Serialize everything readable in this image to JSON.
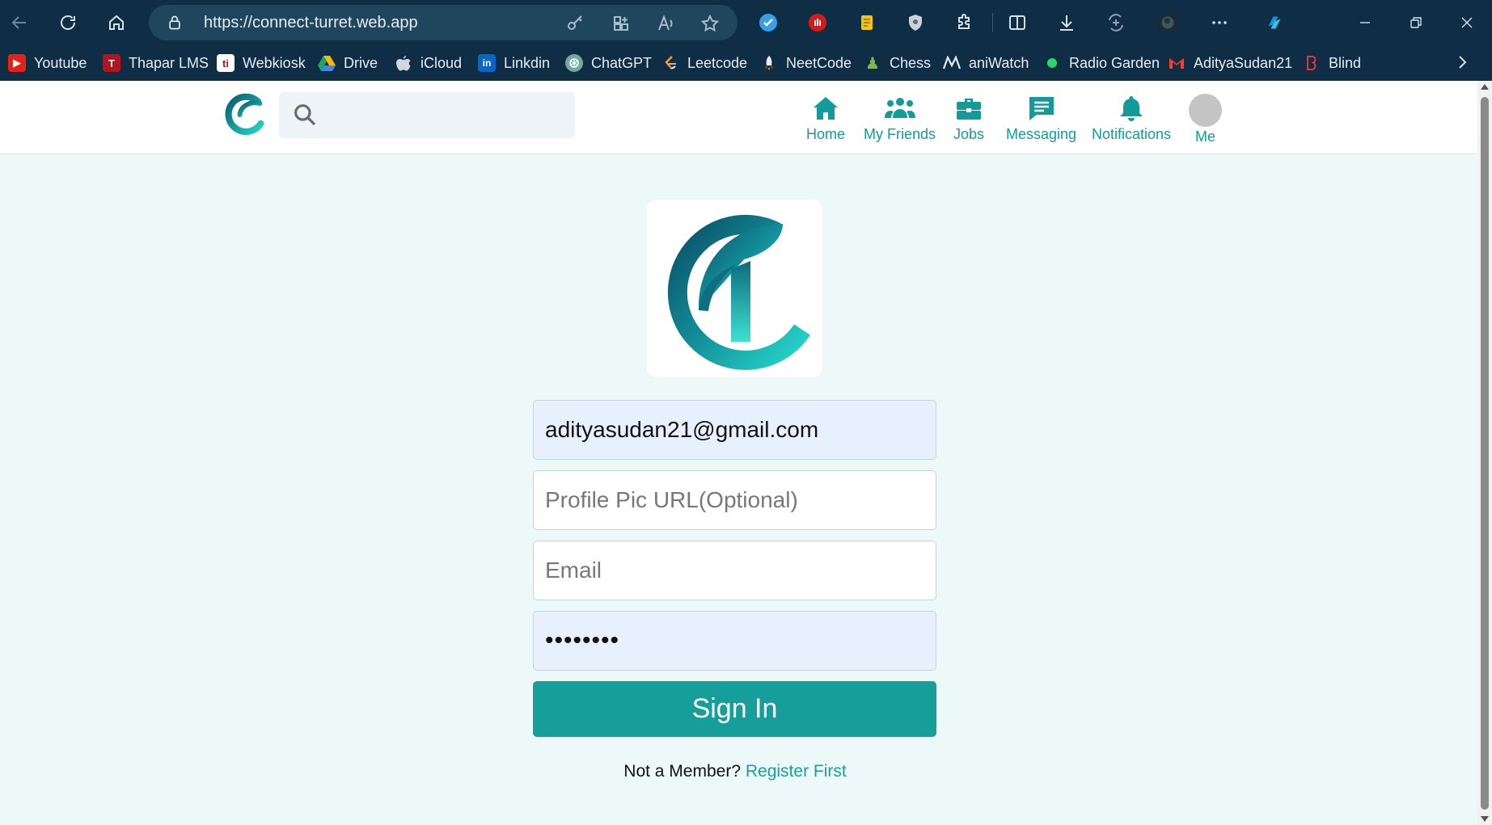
{
  "browser": {
    "url": "https://connect-turret.web.app",
    "bookmarks": [
      {
        "label": "Youtube",
        "icon": "youtube-icon",
        "color": "#e62117",
        "glyph": "▶"
      },
      {
        "label": "Thapar LMS",
        "icon": "thapar-lms-icon",
        "color": "#b3141d",
        "glyph": "T"
      },
      {
        "label": "Webkiosk",
        "icon": "webkiosk-icon",
        "color": "#ffffff",
        "glyph": "ti"
      },
      {
        "label": "Drive",
        "icon": "google-drive-icon",
        "color": "#1fa463",
        "glyph": "▲"
      },
      {
        "label": "iCloud",
        "icon": "apple-icon",
        "color": "#0f2d44",
        "glyph": ""
      },
      {
        "label": "Linkdin",
        "icon": "linkedin-icon",
        "color": "#0a66c2",
        "glyph": "in"
      },
      {
        "label": "ChatGPT",
        "icon": "chatgpt-icon",
        "color": "#74aa9c",
        "glyph": "⚙"
      },
      {
        "label": "Leetcode",
        "icon": "leetcode-icon",
        "color": "#0f2d44",
        "glyph": "⟨"
      },
      {
        "label": "NeetCode",
        "icon": "neetcode-icon",
        "color": "#0f2d44",
        "glyph": "🚀"
      },
      {
        "label": "Chess",
        "icon": "chess-icon",
        "color": "#81b64c",
        "glyph": "♟"
      },
      {
        "label": "aniWatch",
        "icon": "aniwatch-icon",
        "color": "#0f2d44",
        "glyph": "Ѡ"
      },
      {
        "label": "Radio Garden",
        "icon": "radio-garden-icon",
        "color": "#0f2d44",
        "glyph": "●"
      },
      {
        "label": "AdityaSudan21",
        "icon": "gmail-icon",
        "color": "#0f2d44",
        "glyph": "M"
      },
      {
        "label": "Blind",
        "icon": "blind-icon",
        "color": "#0f2d44",
        "glyph": "B"
      }
    ]
  },
  "site": {
    "nav": [
      {
        "label": "Home",
        "icon": "home-icon"
      },
      {
        "label": "My Friends",
        "icon": "friends-icon"
      },
      {
        "label": "Jobs",
        "icon": "briefcase-icon"
      },
      {
        "label": "Messaging",
        "icon": "message-icon"
      },
      {
        "label": "Notifications",
        "icon": "bell-icon"
      },
      {
        "label": "Me",
        "icon": "avatar"
      }
    ],
    "search_placeholder": ""
  },
  "form": {
    "name_value": "adityasudan21@gmail.com",
    "profile_pic_placeholder": "Profile Pic URL(Optional)",
    "email_placeholder": "Email",
    "password_value": "••••••••",
    "submit_label": "Sign In",
    "register_prompt": "Not a Member?",
    "register_link": "Register First"
  },
  "colors": {
    "accent": "#169e9b",
    "page_background": "#edf9f8",
    "browser_chrome": "#0f2d44"
  }
}
